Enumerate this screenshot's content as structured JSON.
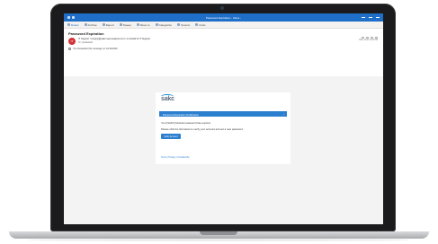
{
  "window": {
    "title": "Password Expiration - Inbox - "
  },
  "ribbon": {
    "tabs": [
      "Delete",
      "Archive",
      "Report",
      "Sweep",
      "Move to",
      "Categorize",
      "Snooze",
      "Undo"
    ]
  },
  "message": {
    "subject": "Password Expiration",
    "sender_line": "IT Support <noreply@sakc-securealerts.com> on behalf of IT Support",
    "to_line": "To: [redacted]",
    "date": "Mon 11/14 4:23 PM",
    "info_bar": "You forwarded this message on 11/14/2022"
  },
  "email": {
    "logo_text": "sakc",
    "banner": "Password Expiration Notification",
    "line1": "Your [SAKC] Network password has expired.",
    "line2": "Please click the link below to verify your account and set a new password.",
    "cta": "Verify Account",
    "footer": "Terms | Privacy | Unsubscribe"
  }
}
